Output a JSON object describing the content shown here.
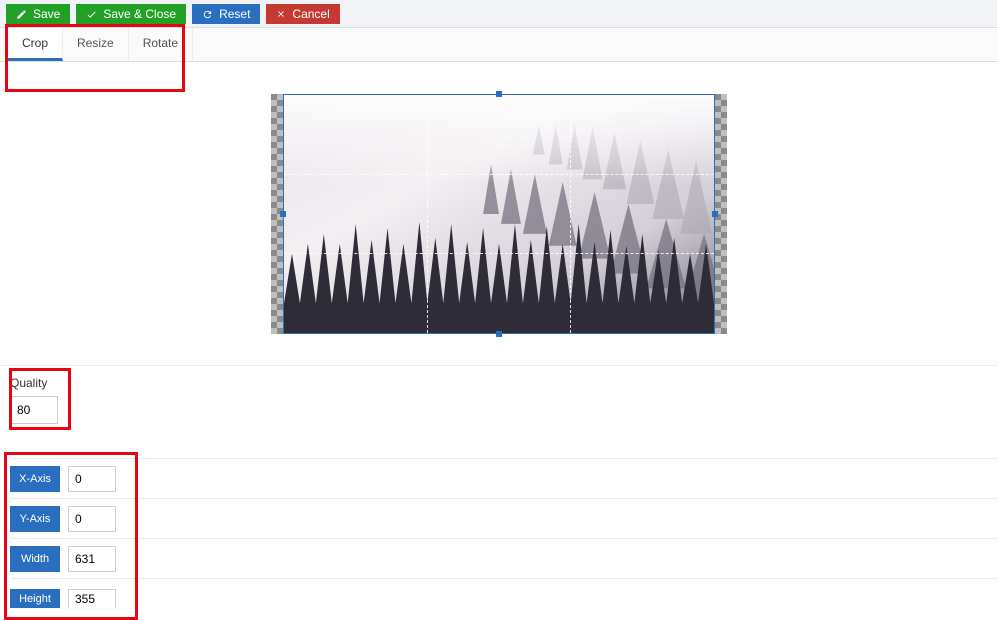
{
  "toolbar": {
    "save": "Save",
    "save_close": "Save & Close",
    "reset": "Reset",
    "cancel": "Cancel"
  },
  "tabs": {
    "crop": "Crop",
    "resize": "Resize",
    "rotate": "Rotate"
  },
  "quality": {
    "label": "Quality",
    "value": "80"
  },
  "axes": {
    "x": {
      "label": "X-Axis",
      "value": "0"
    },
    "y": {
      "label": "Y-Axis",
      "value": "0"
    },
    "w": {
      "label": "Width",
      "value": "631"
    },
    "h": {
      "label": "Height",
      "value": "355"
    }
  },
  "colors": {
    "green": "#23a127",
    "blue": "#2a6fbf",
    "red": "#c43a33",
    "highlight": "#e30613"
  }
}
